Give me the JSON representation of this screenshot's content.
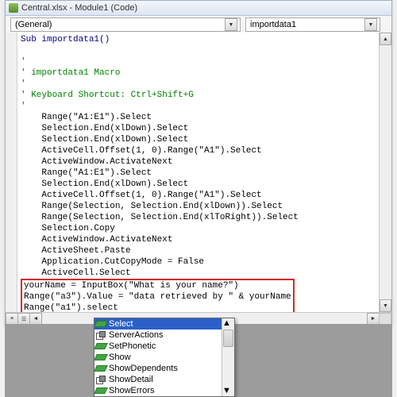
{
  "window": {
    "title": "Central.xlsx - Module1 (Code)"
  },
  "dropdowns": {
    "object": "(General)",
    "procedure": "importdata1"
  },
  "code": {
    "l1": "Sub importdata1()",
    "l2": "'",
    "l3": "' importdata1 Macro",
    "l4": "'",
    "l5": "' Keyboard Shortcut: Ctrl+Shift+G",
    "l6": "'",
    "l7": "    Range(\"A1:E1\").Select",
    "l8": "    Selection.End(xlDown).Select",
    "l9": "    Selection.End(xlDown).Select",
    "l10": "    ActiveCell.Offset(1, 0).Range(\"A1\").Select",
    "l11": "    ActiveWindow.ActivateNext",
    "l12": "    Range(\"A1:E1\").Select",
    "l13": "    Selection.End(xlDown).Select",
    "l14": "    ActiveCell.Offset(1, 0).Range(\"A1\").Select",
    "l15": "    Range(Selection, Selection.End(xlDown)).Select",
    "l16": "    Range(Selection, Selection.End(xlToRight)).Select",
    "l17": "    Selection.Copy",
    "l18": "    ActiveWindow.ActivateNext",
    "l19": "    ActiveSheet.Paste",
    "l20": "    Application.CutCopyMode = False",
    "l21": "    ActiveCell.Select",
    "l22": "yourName = InputBox(\"What is your name?\")",
    "l23": "Range(\"a3\").Value = \"data retrieved by \" & yourName",
    "l24": "Range(\"a1\").select"
  },
  "autocomplete": {
    "items": [
      {
        "label": "Select",
        "kind": "method",
        "selected": true
      },
      {
        "label": "ServerActions",
        "kind": "property",
        "selected": false
      },
      {
        "label": "SetPhonetic",
        "kind": "method",
        "selected": false
      },
      {
        "label": "Show",
        "kind": "method",
        "selected": false
      },
      {
        "label": "ShowDependents",
        "kind": "method",
        "selected": false
      },
      {
        "label": "ShowDetail",
        "kind": "property",
        "selected": false
      },
      {
        "label": "ShowErrors",
        "kind": "method",
        "selected": false
      }
    ]
  }
}
